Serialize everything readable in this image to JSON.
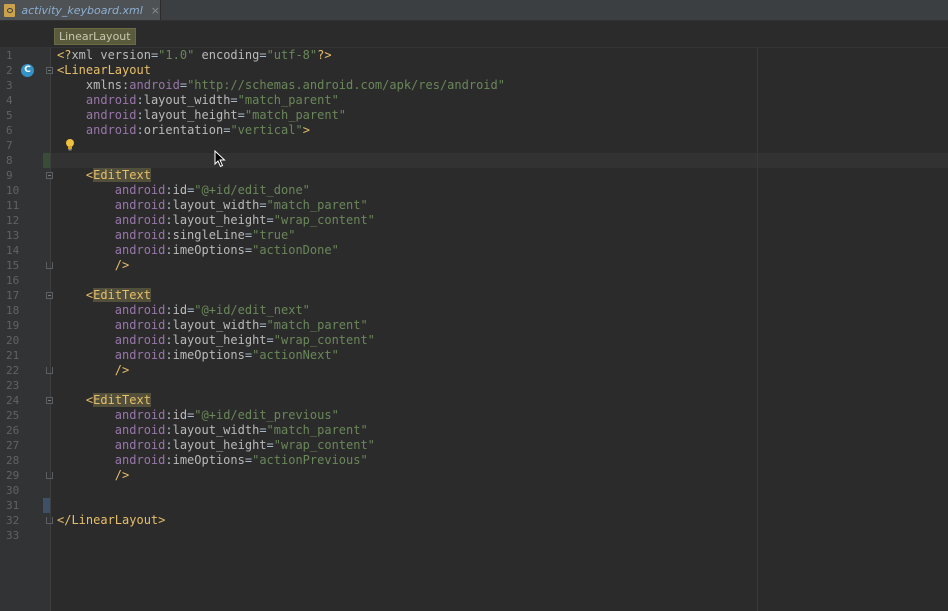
{
  "tab": {
    "label": "activity_keyboard.xml",
    "close": "×"
  },
  "breadcrumb": {
    "label": "LinearLayout"
  },
  "gutter_badge": "C",
  "lines": [
    {
      "n": "1",
      "tokens": [
        [
          "p",
          "<?"
        ],
        [
          "a",
          "xml "
        ],
        [
          "a",
          "version"
        ],
        [
          "plain",
          "="
        ],
        [
          "v",
          "\"1.0\""
        ],
        [
          "plain",
          " "
        ],
        [
          "a",
          "encoding"
        ],
        [
          "plain",
          "="
        ],
        [
          "v",
          "\"utf-8\""
        ],
        [
          "p",
          "?>"
        ]
      ]
    },
    {
      "n": "2",
      "tokens": [
        [
          "p",
          "<"
        ],
        [
          "t",
          "LinearLayout"
        ]
      ],
      "fold": "start"
    },
    {
      "n": "3",
      "tokens": [
        [
          "plain",
          "    "
        ],
        [
          "a",
          "xmlns"
        ],
        [
          "plain",
          ":"
        ],
        [
          "ns",
          "android"
        ],
        [
          "plain",
          "="
        ],
        [
          "v",
          "\"http://schemas.android.com/apk/res/android\""
        ]
      ]
    },
    {
      "n": "4",
      "tokens": [
        [
          "plain",
          "    "
        ],
        [
          "ns",
          "android"
        ],
        [
          "plain",
          ":"
        ],
        [
          "a",
          "layout_width"
        ],
        [
          "plain",
          "="
        ],
        [
          "v",
          "\"match_parent\""
        ]
      ]
    },
    {
      "n": "5",
      "tokens": [
        [
          "plain",
          "    "
        ],
        [
          "ns",
          "android"
        ],
        [
          "plain",
          ":"
        ],
        [
          "a",
          "layout_height"
        ],
        [
          "plain",
          "="
        ],
        [
          "v",
          "\"match_parent\""
        ]
      ]
    },
    {
      "n": "6",
      "tokens": [
        [
          "plain",
          "    "
        ],
        [
          "ns",
          "android"
        ],
        [
          "plain",
          ":"
        ],
        [
          "a",
          "orientation"
        ],
        [
          "plain",
          "="
        ],
        [
          "v",
          "\"vertical\""
        ],
        [
          "p",
          ">"
        ]
      ]
    },
    {
      "n": "7",
      "tokens": []
    },
    {
      "n": "8",
      "tokens": []
    },
    {
      "n": "9",
      "tokens": [
        [
          "plain",
          "    "
        ],
        [
          "p",
          "<"
        ],
        [
          "th",
          "EditText"
        ]
      ],
      "fold": "start"
    },
    {
      "n": "10",
      "tokens": [
        [
          "plain",
          "        "
        ],
        [
          "ns",
          "android"
        ],
        [
          "plain",
          ":"
        ],
        [
          "a",
          "id"
        ],
        [
          "plain",
          "="
        ],
        [
          "v",
          "\"@+id/edit_done\""
        ]
      ]
    },
    {
      "n": "11",
      "tokens": [
        [
          "plain",
          "        "
        ],
        [
          "ns",
          "android"
        ],
        [
          "plain",
          ":"
        ],
        [
          "a",
          "layout_width"
        ],
        [
          "plain",
          "="
        ],
        [
          "v",
          "\"match_parent\""
        ]
      ]
    },
    {
      "n": "12",
      "tokens": [
        [
          "plain",
          "        "
        ],
        [
          "ns",
          "android"
        ],
        [
          "plain",
          ":"
        ],
        [
          "a",
          "layout_height"
        ],
        [
          "plain",
          "="
        ],
        [
          "v",
          "\"wrap_content\""
        ]
      ]
    },
    {
      "n": "13",
      "tokens": [
        [
          "plain",
          "        "
        ],
        [
          "ns",
          "android"
        ],
        [
          "plain",
          ":"
        ],
        [
          "a",
          "singleLine"
        ],
        [
          "plain",
          "="
        ],
        [
          "v",
          "\"true\""
        ]
      ]
    },
    {
      "n": "14",
      "tokens": [
        [
          "plain",
          "        "
        ],
        [
          "ns",
          "android"
        ],
        [
          "plain",
          ":"
        ],
        [
          "a",
          "imeOptions"
        ],
        [
          "plain",
          "="
        ],
        [
          "v",
          "\"actionDone\""
        ]
      ]
    },
    {
      "n": "15",
      "tokens": [
        [
          "plain",
          "        "
        ],
        [
          "p",
          "/>"
        ]
      ],
      "fold": "end"
    },
    {
      "n": "16",
      "tokens": []
    },
    {
      "n": "17",
      "tokens": [
        [
          "plain",
          "    "
        ],
        [
          "p",
          "<"
        ],
        [
          "th",
          "EditText"
        ]
      ],
      "fold": "start"
    },
    {
      "n": "18",
      "tokens": [
        [
          "plain",
          "        "
        ],
        [
          "ns",
          "android"
        ],
        [
          "plain",
          ":"
        ],
        [
          "a",
          "id"
        ],
        [
          "plain",
          "="
        ],
        [
          "v",
          "\"@+id/edit_next\""
        ]
      ]
    },
    {
      "n": "19",
      "tokens": [
        [
          "plain",
          "        "
        ],
        [
          "ns",
          "android"
        ],
        [
          "plain",
          ":"
        ],
        [
          "a",
          "layout_width"
        ],
        [
          "plain",
          "="
        ],
        [
          "v",
          "\"match_parent\""
        ]
      ]
    },
    {
      "n": "20",
      "tokens": [
        [
          "plain",
          "        "
        ],
        [
          "ns",
          "android"
        ],
        [
          "plain",
          ":"
        ],
        [
          "a",
          "layout_height"
        ],
        [
          "plain",
          "="
        ],
        [
          "v",
          "\"wrap_content\""
        ]
      ]
    },
    {
      "n": "21",
      "tokens": [
        [
          "plain",
          "        "
        ],
        [
          "ns",
          "android"
        ],
        [
          "plain",
          ":"
        ],
        [
          "a",
          "imeOptions"
        ],
        [
          "plain",
          "="
        ],
        [
          "v",
          "\"actionNext\""
        ]
      ]
    },
    {
      "n": "22",
      "tokens": [
        [
          "plain",
          "        "
        ],
        [
          "p",
          "/>"
        ]
      ],
      "fold": "end"
    },
    {
      "n": "23",
      "tokens": []
    },
    {
      "n": "24",
      "tokens": [
        [
          "plain",
          "    "
        ],
        [
          "p",
          "<"
        ],
        [
          "th",
          "EditText"
        ]
      ],
      "fold": "start"
    },
    {
      "n": "25",
      "tokens": [
        [
          "plain",
          "        "
        ],
        [
          "ns",
          "android"
        ],
        [
          "plain",
          ":"
        ],
        [
          "a",
          "id"
        ],
        [
          "plain",
          "="
        ],
        [
          "v",
          "\"@+id/edit_previous\""
        ]
      ]
    },
    {
      "n": "26",
      "tokens": [
        [
          "plain",
          "        "
        ],
        [
          "ns",
          "android"
        ],
        [
          "plain",
          ":"
        ],
        [
          "a",
          "layout_width"
        ],
        [
          "plain",
          "="
        ],
        [
          "v",
          "\"match_parent\""
        ]
      ]
    },
    {
      "n": "27",
      "tokens": [
        [
          "plain",
          "        "
        ],
        [
          "ns",
          "android"
        ],
        [
          "plain",
          ":"
        ],
        [
          "a",
          "layout_height"
        ],
        [
          "plain",
          "="
        ],
        [
          "v",
          "\"wrap_content\""
        ]
      ]
    },
    {
      "n": "28",
      "tokens": [
        [
          "plain",
          "        "
        ],
        [
          "ns",
          "android"
        ],
        [
          "plain",
          ":"
        ],
        [
          "a",
          "imeOptions"
        ],
        [
          "plain",
          "="
        ],
        [
          "v",
          "\"actionPrevious\""
        ]
      ]
    },
    {
      "n": "29",
      "tokens": [
        [
          "plain",
          "        "
        ],
        [
          "p",
          "/>"
        ]
      ],
      "fold": "end"
    },
    {
      "n": "30",
      "tokens": []
    },
    {
      "n": "31",
      "tokens": []
    },
    {
      "n": "32",
      "tokens": [
        [
          "p",
          "</"
        ],
        [
          "t",
          "LinearLayout"
        ],
        [
          "p",
          ">"
        ]
      ],
      "fold": "end"
    },
    {
      "n": "33",
      "tokens": []
    }
  ],
  "colors": {
    "background": "#2b2b2b",
    "gutter": "#313335",
    "tag": "#e8bf6a",
    "attribute": "#bababa",
    "namespace": "#9876aa",
    "value": "#6a8759",
    "change_marker": "#384c38",
    "change_marker_blue": "#3d5066"
  }
}
